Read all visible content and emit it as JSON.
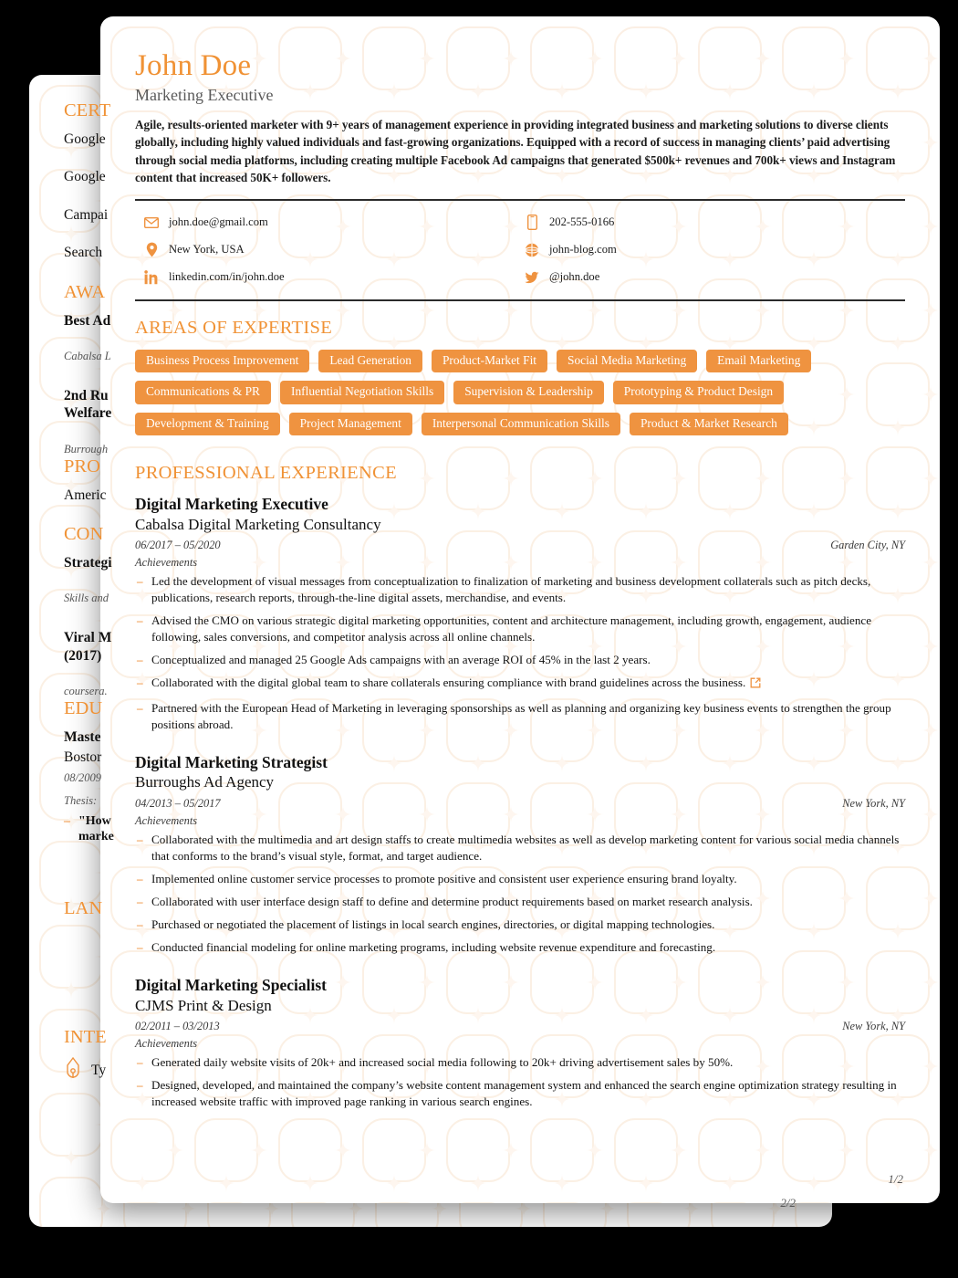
{
  "accent": "#F09235",
  "tag_bg": "#EF9340",
  "front_page": {
    "page_number": "1/2",
    "header": {
      "name": "John Doe",
      "role": "Marketing Executive",
      "summary": "Agile, results-oriented marketer with 9+ years of management experience in providing integrated business and marketing solutions to diverse clients globally, including highly valued individuals and fast-growing organizations. Equipped with a record of success in managing clients’ paid advertising through social media platforms, including creating multiple Facebook Ad campaigns that generated $500k+ revenues and 700k+ views and Instagram content that increased 50K+ followers."
    },
    "contacts": [
      {
        "icon": "envelope-icon",
        "text": "john.doe@gmail.com"
      },
      {
        "icon": "phone-icon",
        "text": "202-555-0166"
      },
      {
        "icon": "location-pin-icon",
        "text": "New York, USA"
      },
      {
        "icon": "globe-icon",
        "text": "john-blog.com"
      },
      {
        "icon": "linkedin-icon",
        "text": "linkedin.com/in/john.doe"
      },
      {
        "icon": "twitter-icon",
        "text": "@john.doe"
      }
    ],
    "expertise": {
      "heading": "AREAS OF EXPERTISE",
      "tags": [
        "Business Process Improvement",
        "Lead Generation",
        "Product-Market Fit",
        "Social Media Marketing",
        "Email Marketing",
        "Communications & PR",
        "Influential Negotiation Skills",
        "Supervision & Leadership",
        "Prototyping & Product Design",
        "Development & Training",
        "Project Management",
        "Interpersonal Communication Skills",
        "Product & Market Research"
      ]
    },
    "experience": {
      "heading": "PROFESSIONAL EXPERIENCE",
      "achievements_label": "Achievements",
      "jobs": [
        {
          "title": "Digital Marketing Executive",
          "org": "Cabalsa Digital Marketing Consultancy",
          "dates": "06/2017 – 05/2020",
          "location": "Garden City, NY",
          "bullets": [
            {
              "text": "Led the development of visual messages from conceptualization to finalization of marketing and business development collaterals such as pitch decks, publications, research reports, through-the-line digital assets, merchandise, and events.",
              "link": false
            },
            {
              "text": "Advised the CMO on various strategic digital marketing opportunities, content and architecture management, including growth, engagement, audience following, sales conversions, and competitor analysis across all online channels.",
              "link": false
            },
            {
              "text": "Conceptualized and managed 25 Google Ads campaigns with an average ROI of 45% in the last 2 years.",
              "link": false
            },
            {
              "text": "Collaborated with the digital global team to share collaterals ensuring compliance with brand guidelines across the business.",
              "link": true
            },
            {
              "text": "Partnered with the European Head of Marketing in leveraging sponsorships as well as planning and organizing key business events to strengthen the group positions abroad.",
              "link": false
            }
          ]
        },
        {
          "title": "Digital Marketing Strategist",
          "org": "Burroughs Ad Agency",
          "dates": "04/2013 – 05/2017",
          "location": "New York, NY",
          "bullets": [
            {
              "text": "Collaborated with the multimedia and art design staffs to create multimedia websites as well as develop marketing content for various social media channels that conforms to the brand’s visual style, format, and target audience.",
              "link": false
            },
            {
              "text": "Implemented online customer service processes to promote positive and consistent user experience ensuring brand loyalty.",
              "link": false
            },
            {
              "text": "Collaborated with user interface design staff to define and determine product requirements based on market research analysis.",
              "link": false
            },
            {
              "text": "Purchased or negotiated the placement of listings in local search engines, directories, or digital mapping technologies.",
              "link": false
            },
            {
              "text": "Conducted financial modeling for online marketing programs, including website revenue expenditure and forecasting.",
              "link": false
            }
          ]
        },
        {
          "title": "Digital Marketing Specialist",
          "org": "CJMS Print & Design",
          "dates": "02/2011 – 03/2013",
          "location": "New York, NY",
          "bullets": [
            {
              "text": "Generated daily website visits of 20k+ and increased social media following to 20k+ driving advertisement sales by 50%.",
              "link": false
            },
            {
              "text": "Designed, developed, and maintained the company’s website content management system and enhanced the search engine optimization strategy resulting in increased website traffic with improved page ranking in various search engines.",
              "link": false
            }
          ]
        }
      ]
    }
  },
  "back_page": {
    "page_number": "2/2",
    "sections": [
      {
        "heading": "CERT",
        "items": [
          {
            "text": "Google",
            "bold": false,
            "sub": ""
          },
          {
            "text": "Google",
            "bold": false,
            "sub": ""
          },
          {
            "text": "Campai",
            "bold": false,
            "sub": ""
          },
          {
            "text": "Search ",
            "bold": false,
            "sub": ""
          }
        ]
      },
      {
        "heading": "AWA",
        "items": [
          {
            "text": "Best Ad",
            "bold": true,
            "sub": "Cabalsa L"
          },
          {
            "text": "2nd Ru\nWelfare",
            "bold": true,
            "sub": "Burrough"
          }
        ]
      },
      {
        "heading": "PRO",
        "items": [
          {
            "text": "Americ",
            "bold": false,
            "sub": ""
          }
        ]
      },
      {
        "heading": "CON",
        "items": [
          {
            "text": "Strategi",
            "bold": true,
            "sub": "Skills and"
          },
          {
            "text": "Viral M\n(2017)",
            "bold": true,
            "sub": "coursera."
          }
        ]
      },
      {
        "heading": "EDU",
        "items": [
          {
            "text": "Maste",
            "bold": true,
            "sub": ""
          },
          {
            "text": "Bostor",
            "bold": false,
            "sub": "08/2009"
          },
          {
            "text": "",
            "bold": false,
            "sub": "Thesis:"
          },
          {
            "text": "\"How\nmarke",
            "bold": true,
            "sub": ""
          }
        ]
      },
      {
        "heading": "LAN",
        "items": []
      },
      {
        "heading": "INTE",
        "items": [
          {
            "text": "Ty",
            "bold": false,
            "sub": ""
          }
        ]
      }
    ]
  }
}
